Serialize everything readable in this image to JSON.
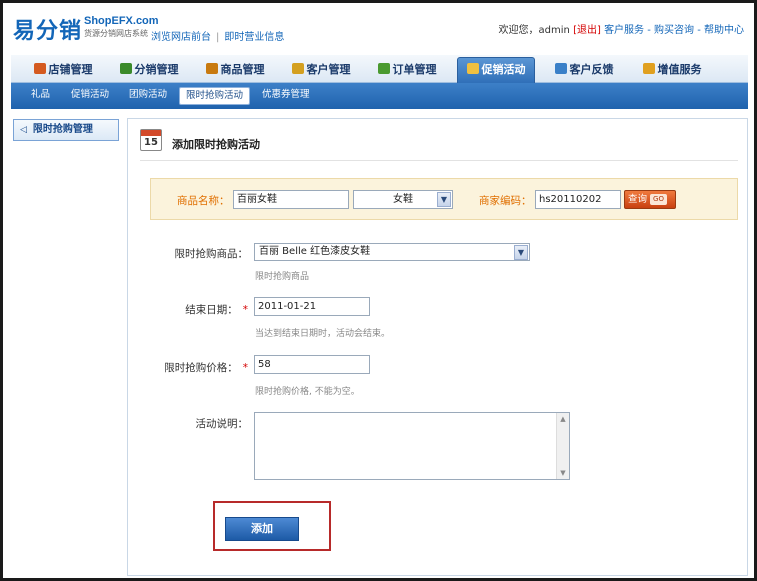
{
  "header": {
    "logo_cn": "易分销",
    "logo_en": "ShopEFX.com",
    "logo_sub": "货源分销网店系统",
    "links": [
      "浏览网店前台",
      "即时营业信息"
    ],
    "welcome": "欢迎您，admin",
    "logout": "退出",
    "user_links": [
      "客户服务",
      "购买咨询",
      "帮助中心"
    ]
  },
  "main_nav": [
    {
      "label": "店铺管理",
      "icon": "shop-icon",
      "color": "#d45a20"
    },
    {
      "label": "分销管理",
      "icon": "distribution-icon",
      "color": "#3a8a2a"
    },
    {
      "label": "商品管理",
      "icon": "goods-icon",
      "color": "#c87a10"
    },
    {
      "label": "客户管理",
      "icon": "customer-icon",
      "color": "#d4a020"
    },
    {
      "label": "订单管理",
      "icon": "order-icon",
      "color": "#4a9a30"
    },
    {
      "label": "促销活动",
      "icon": "promotion-icon",
      "color": "#f0c040",
      "active": true
    },
    {
      "label": "客户反馈",
      "icon": "feedback-icon",
      "color": "#3a80c8"
    },
    {
      "label": "增值服务",
      "icon": "service-icon",
      "color": "#e0a020"
    }
  ],
  "sub_nav": [
    {
      "label": "礼品"
    },
    {
      "label": "促销活动"
    },
    {
      "label": "团购活动"
    },
    {
      "label": "限时抢购活动",
      "active": true
    },
    {
      "label": "优惠券管理"
    }
  ],
  "sidebar": {
    "button": "限时抢购管理"
  },
  "panel": {
    "title": "添加限时抢购活动",
    "calendar_day": "15"
  },
  "search": {
    "name_label": "商品名称：",
    "name_value": "百丽女鞋",
    "category_value": "女鞋",
    "code_label": "商家编码：",
    "code_value": "hs20110202",
    "query_label": "查询",
    "go_label": "GO"
  },
  "form": {
    "product_label": "限时抢购商品：",
    "product_value": "百丽  Belle 红色漆皮女鞋",
    "product_hint": "限时抢购商品",
    "end_date_label": "结束日期：",
    "end_date_value": "2011-01-21",
    "end_date_hint": "当达到结束日期时，活动会结束。",
    "price_label": "限时抢购价格：",
    "price_value": "58",
    "price_hint": "限时抢购价格, 不能为空。",
    "desc_label": "活动说明：",
    "required_mark": "*",
    "submit_label": "添加"
  }
}
